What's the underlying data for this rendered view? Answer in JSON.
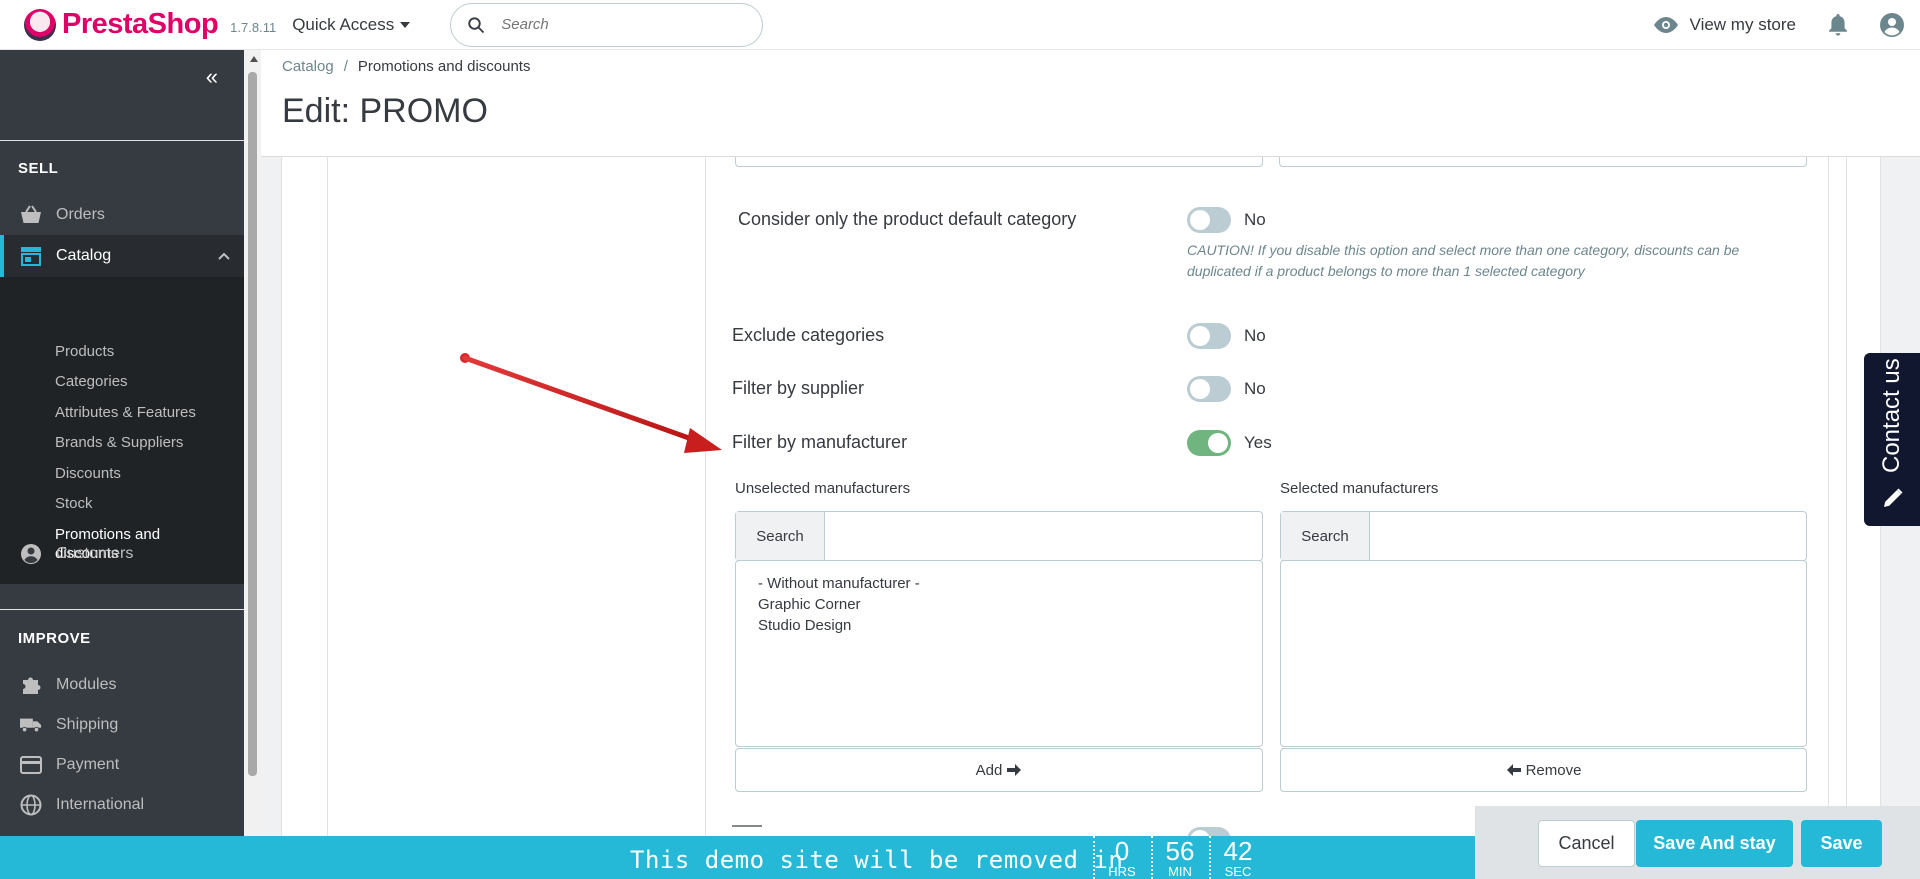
{
  "header": {
    "brand": "PrestaShop",
    "version": "1.7.8.11",
    "quick_access": "Quick Access",
    "search_placeholder": "Search",
    "view_store": "View my store"
  },
  "sidebar": {
    "sell_title": "SELL",
    "improve_title": "IMPROVE",
    "orders": "Orders",
    "catalog": "Catalog",
    "catalog_sub": [
      "Products",
      "Categories",
      "Attributes & Features",
      "Brands & Suppliers",
      "Discounts",
      "Stock",
      "Promotions and",
      "discounts"
    ],
    "customers": "Customers",
    "modules": "Modules",
    "shipping": "Shipping",
    "payment": "Payment",
    "international": "International"
  },
  "breadcrumb": {
    "parent": "Catalog",
    "separator": "/",
    "current": "Promotions and discounts"
  },
  "page_title": "Edit: PROMO",
  "form": {
    "default_category": {
      "label": "Consider only the product default category",
      "value": "No",
      "on": false
    },
    "caution": "CAUTION! If you disable this option and select more than one category, discounts can be duplicated if a product belongs to more than 1 selected category",
    "exclude_categories": {
      "label": "Exclude categories",
      "value": "No",
      "on": false
    },
    "filter_supplier": {
      "label": "Filter by supplier",
      "value": "No",
      "on": false
    },
    "filter_manufacturer": {
      "label": "Filter by manufacturer",
      "value": "Yes",
      "on": true
    },
    "unselected_label": "Unselected manufacturers",
    "selected_label": "Selected manufacturers",
    "search_addon": "Search",
    "unselected_items": [
      "- Without manufacturer -",
      "Graphic Corner",
      "Studio Design"
    ],
    "add_button": "Add",
    "remove_button": "Remove"
  },
  "contact": {
    "label": "Contact us"
  },
  "demo_bar": {
    "message": "This demo site will be removed in",
    "hours": "0",
    "hours_unit": "HRS",
    "minutes": "56",
    "minutes_unit": "MIN",
    "seconds": "42",
    "seconds_unit": "SEC"
  },
  "actions": {
    "cancel": "Cancel",
    "save_and_stay": "Save And stay",
    "save": "Save"
  },
  "colors": {
    "brand": "#df0067",
    "accent": "#25b9d7",
    "sidebar_bg": "#363a41",
    "switch_on": "#70b580",
    "switch_off": "#bbcdd2",
    "annotation_arrow": "#d9262b"
  }
}
